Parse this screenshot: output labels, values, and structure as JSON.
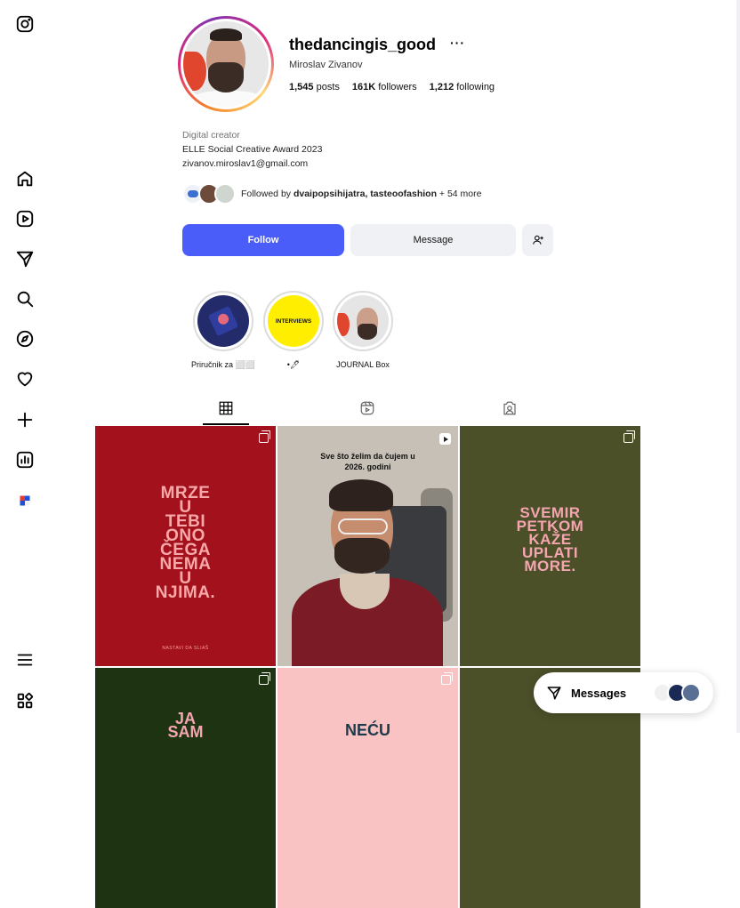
{
  "profile": {
    "username": "thedancingis_good",
    "more": "···",
    "full_name": "Miroslav Zivanov",
    "stats": {
      "posts_count": "1,545",
      "posts_label": "posts",
      "followers_count": "161K",
      "followers_label": "followers",
      "following_count": "1,212",
      "following_label": "following"
    },
    "bio": {
      "category": "Digital creator",
      "line1": "ELLE Social Creative Award 2023",
      "line2": "zivanov.miroslav1@gmail.com"
    },
    "followed_by": {
      "prefix": "Followed by ",
      "names": "dvaipopsihijatra, tasteoofashion",
      "suffix": " + 54 more"
    }
  },
  "actions": {
    "follow_label": "Follow",
    "message_label": "Message",
    "add_icon": "person-add-icon"
  },
  "highlights": [
    {
      "label": "Priručnik za ⬜⬜"
    },
    {
      "label": "•🖊",
      "image_text": "INTERVIEWS"
    },
    {
      "label": "JOURNAL Box"
    }
  ],
  "tabs": [
    {
      "icon": "grid-icon",
      "active": true
    },
    {
      "icon": "reels-icon",
      "active": false
    },
    {
      "icon": "tagged-icon",
      "active": false
    }
  ],
  "posts": {
    "p1_text": "MRZE\nU\nTEBI\nONO\nČEGA\nNEMA\nU\nNJIMA.",
    "p1_small": "NASTAVI DA SLIAŠ",
    "p2_caption": "Sve što želim da čujem u\n2026. godini",
    "p3_text": "SVEMIR\nPETKOM\nKAŽE\nUPLATI\nMORE.",
    "p4_text": "JA\nSAM",
    "p5_text": "NEĆU"
  },
  "messages": {
    "label": "Messages"
  },
  "colors": {
    "follow_button": "#4a5df9",
    "post_red": "#a3111c",
    "post_olive": "#4c5029",
    "post_pink": "#f9c3c3",
    "post_text_pink": "#f4a5b0"
  },
  "sidebar": {
    "icons": [
      "instagram-icon",
      "home-icon",
      "reels-icon",
      "send-icon",
      "search-icon",
      "explore-icon",
      "heart-icon",
      "create-icon",
      "dashboard-icon",
      "profile-icon",
      "menu-icon",
      "apps-icon"
    ]
  }
}
